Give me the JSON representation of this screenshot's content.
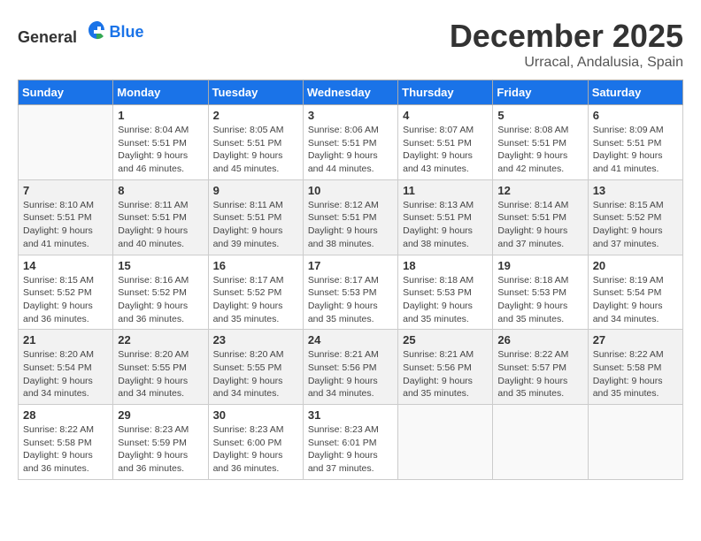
{
  "logo": {
    "text_general": "General",
    "text_blue": "Blue"
  },
  "title": "December 2025",
  "subtitle": "Urracal, Andalusia, Spain",
  "days_of_week": [
    "Sunday",
    "Monday",
    "Tuesday",
    "Wednesday",
    "Thursday",
    "Friday",
    "Saturday"
  ],
  "weeks": [
    [
      {
        "day": "",
        "sunrise": "",
        "sunset": "",
        "daylight": ""
      },
      {
        "day": "1",
        "sunrise": "Sunrise: 8:04 AM",
        "sunset": "Sunset: 5:51 PM",
        "daylight": "Daylight: 9 hours and 46 minutes."
      },
      {
        "day": "2",
        "sunrise": "Sunrise: 8:05 AM",
        "sunset": "Sunset: 5:51 PM",
        "daylight": "Daylight: 9 hours and 45 minutes."
      },
      {
        "day": "3",
        "sunrise": "Sunrise: 8:06 AM",
        "sunset": "Sunset: 5:51 PM",
        "daylight": "Daylight: 9 hours and 44 minutes."
      },
      {
        "day": "4",
        "sunrise": "Sunrise: 8:07 AM",
        "sunset": "Sunset: 5:51 PM",
        "daylight": "Daylight: 9 hours and 43 minutes."
      },
      {
        "day": "5",
        "sunrise": "Sunrise: 8:08 AM",
        "sunset": "Sunset: 5:51 PM",
        "daylight": "Daylight: 9 hours and 42 minutes."
      },
      {
        "day": "6",
        "sunrise": "Sunrise: 8:09 AM",
        "sunset": "Sunset: 5:51 PM",
        "daylight": "Daylight: 9 hours and 41 minutes."
      }
    ],
    [
      {
        "day": "7",
        "sunrise": "Sunrise: 8:10 AM",
        "sunset": "Sunset: 5:51 PM",
        "daylight": "Daylight: 9 hours and 41 minutes."
      },
      {
        "day": "8",
        "sunrise": "Sunrise: 8:11 AM",
        "sunset": "Sunset: 5:51 PM",
        "daylight": "Daylight: 9 hours and 40 minutes."
      },
      {
        "day": "9",
        "sunrise": "Sunrise: 8:11 AM",
        "sunset": "Sunset: 5:51 PM",
        "daylight": "Daylight: 9 hours and 39 minutes."
      },
      {
        "day": "10",
        "sunrise": "Sunrise: 8:12 AM",
        "sunset": "Sunset: 5:51 PM",
        "daylight": "Daylight: 9 hours and 38 minutes."
      },
      {
        "day": "11",
        "sunrise": "Sunrise: 8:13 AM",
        "sunset": "Sunset: 5:51 PM",
        "daylight": "Daylight: 9 hours and 38 minutes."
      },
      {
        "day": "12",
        "sunrise": "Sunrise: 8:14 AM",
        "sunset": "Sunset: 5:51 PM",
        "daylight": "Daylight: 9 hours and 37 minutes."
      },
      {
        "day": "13",
        "sunrise": "Sunrise: 8:15 AM",
        "sunset": "Sunset: 5:52 PM",
        "daylight": "Daylight: 9 hours and 37 minutes."
      }
    ],
    [
      {
        "day": "14",
        "sunrise": "Sunrise: 8:15 AM",
        "sunset": "Sunset: 5:52 PM",
        "daylight": "Daylight: 9 hours and 36 minutes."
      },
      {
        "day": "15",
        "sunrise": "Sunrise: 8:16 AM",
        "sunset": "Sunset: 5:52 PM",
        "daylight": "Daylight: 9 hours and 36 minutes."
      },
      {
        "day": "16",
        "sunrise": "Sunrise: 8:17 AM",
        "sunset": "Sunset: 5:52 PM",
        "daylight": "Daylight: 9 hours and 35 minutes."
      },
      {
        "day": "17",
        "sunrise": "Sunrise: 8:17 AM",
        "sunset": "Sunset: 5:53 PM",
        "daylight": "Daylight: 9 hours and 35 minutes."
      },
      {
        "day": "18",
        "sunrise": "Sunrise: 8:18 AM",
        "sunset": "Sunset: 5:53 PM",
        "daylight": "Daylight: 9 hours and 35 minutes."
      },
      {
        "day": "19",
        "sunrise": "Sunrise: 8:18 AM",
        "sunset": "Sunset: 5:53 PM",
        "daylight": "Daylight: 9 hours and 35 minutes."
      },
      {
        "day": "20",
        "sunrise": "Sunrise: 8:19 AM",
        "sunset": "Sunset: 5:54 PM",
        "daylight": "Daylight: 9 hours and 34 minutes."
      }
    ],
    [
      {
        "day": "21",
        "sunrise": "Sunrise: 8:20 AM",
        "sunset": "Sunset: 5:54 PM",
        "daylight": "Daylight: 9 hours and 34 minutes."
      },
      {
        "day": "22",
        "sunrise": "Sunrise: 8:20 AM",
        "sunset": "Sunset: 5:55 PM",
        "daylight": "Daylight: 9 hours and 34 minutes."
      },
      {
        "day": "23",
        "sunrise": "Sunrise: 8:20 AM",
        "sunset": "Sunset: 5:55 PM",
        "daylight": "Daylight: 9 hours and 34 minutes."
      },
      {
        "day": "24",
        "sunrise": "Sunrise: 8:21 AM",
        "sunset": "Sunset: 5:56 PM",
        "daylight": "Daylight: 9 hours and 34 minutes."
      },
      {
        "day": "25",
        "sunrise": "Sunrise: 8:21 AM",
        "sunset": "Sunset: 5:56 PM",
        "daylight": "Daylight: 9 hours and 35 minutes."
      },
      {
        "day": "26",
        "sunrise": "Sunrise: 8:22 AM",
        "sunset": "Sunset: 5:57 PM",
        "daylight": "Daylight: 9 hours and 35 minutes."
      },
      {
        "day": "27",
        "sunrise": "Sunrise: 8:22 AM",
        "sunset": "Sunset: 5:58 PM",
        "daylight": "Daylight: 9 hours and 35 minutes."
      }
    ],
    [
      {
        "day": "28",
        "sunrise": "Sunrise: 8:22 AM",
        "sunset": "Sunset: 5:58 PM",
        "daylight": "Daylight: 9 hours and 36 minutes."
      },
      {
        "day": "29",
        "sunrise": "Sunrise: 8:23 AM",
        "sunset": "Sunset: 5:59 PM",
        "daylight": "Daylight: 9 hours and 36 minutes."
      },
      {
        "day": "30",
        "sunrise": "Sunrise: 8:23 AM",
        "sunset": "Sunset: 6:00 PM",
        "daylight": "Daylight: 9 hours and 36 minutes."
      },
      {
        "day": "31",
        "sunrise": "Sunrise: 8:23 AM",
        "sunset": "Sunset: 6:01 PM",
        "daylight": "Daylight: 9 hours and 37 minutes."
      },
      {
        "day": "",
        "sunrise": "",
        "sunset": "",
        "daylight": ""
      },
      {
        "day": "",
        "sunrise": "",
        "sunset": "",
        "daylight": ""
      },
      {
        "day": "",
        "sunrise": "",
        "sunset": "",
        "daylight": ""
      }
    ]
  ]
}
